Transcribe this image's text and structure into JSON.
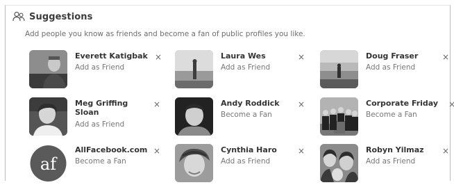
{
  "header": {
    "title": "Suggestions",
    "subtitle": "Add people you know as friends and become a fan of public profiles you like."
  },
  "suggestions": [
    {
      "name": "Everett Katigbak",
      "action": "Add as Friend"
    },
    {
      "name": "Laura Wes",
      "action": "Add as Friend"
    },
    {
      "name": "Doug Fraser",
      "action": "Add as Friend"
    },
    {
      "name": "Meg Griffing Sloan",
      "action": "Add as Friend"
    },
    {
      "name": "Andy Roddick",
      "action": "Become a Fan"
    },
    {
      "name": "Corporate Friday",
      "action": "Become a Fan"
    },
    {
      "name": "AllFacebook.com",
      "action": "Become a Fan"
    },
    {
      "name": "Cynthia Haro",
      "action": "Add as Friend"
    },
    {
      "name": "Robyn Yilmaz",
      "action": "Add as Friend"
    }
  ],
  "close_glyph": "×",
  "logo_text": "af",
  "icons": {
    "header": "people-icon",
    "dismiss": "close-icon"
  }
}
